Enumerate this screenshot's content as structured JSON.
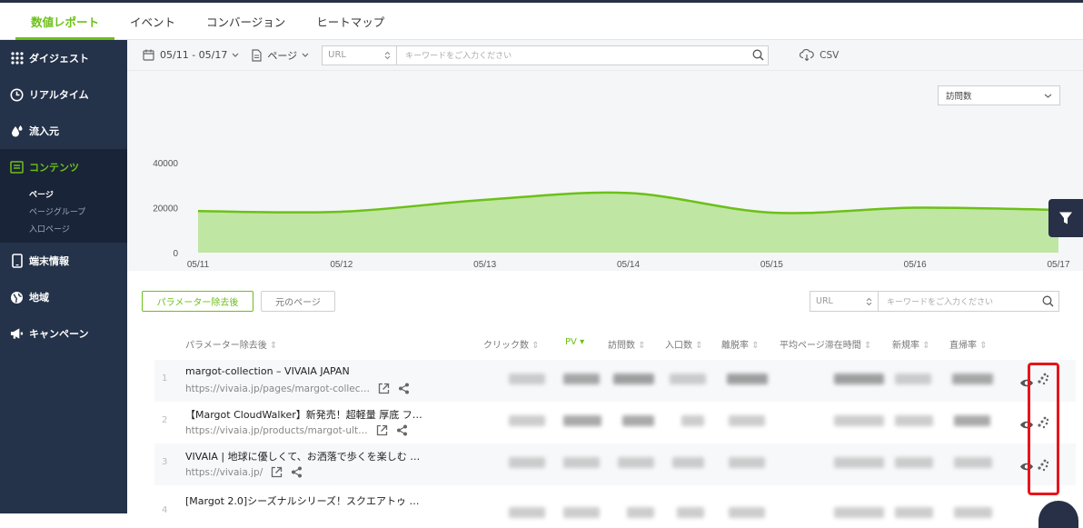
{
  "topnav": {
    "tabs": [
      {
        "label": "数値レポート",
        "active": true
      },
      {
        "label": "イベント",
        "active": false
      },
      {
        "label": "コンバージョン",
        "active": false
      },
      {
        "label": "ヒートマップ",
        "active": false
      }
    ]
  },
  "sidebar": {
    "items": [
      {
        "label": "ダイジェスト",
        "icon": "grid-icon"
      },
      {
        "label": "リアルタイム",
        "icon": "clock-icon"
      },
      {
        "label": "流入元",
        "icon": "drops-icon"
      },
      {
        "label": "コンテンツ",
        "icon": "content-icon",
        "active": true
      },
      {
        "label": "端末情報",
        "icon": "device-icon"
      },
      {
        "label": "地域",
        "icon": "globe-icon"
      },
      {
        "label": "キャンペーン",
        "icon": "megaphone-icon"
      }
    ],
    "content_sub": [
      "ページ",
      "ページグループ",
      "入口ページ"
    ]
  },
  "filterbar": {
    "date_range": "05/11 - 05/17",
    "page_select": "ページ",
    "url_select": "URL",
    "keyword_placeholder": "キーワードをご入力ください",
    "csv_label": "CSV"
  },
  "chart_select": "訪問数",
  "chart_data": {
    "type": "area",
    "x": [
      "05/11",
      "05/12",
      "05/13",
      "05/14",
      "05/15",
      "05/16",
      "05/17"
    ],
    "series": [
      {
        "values": [
          18500,
          18200,
          23500,
          26500,
          17800,
          20000,
          19000
        ]
      }
    ],
    "yticks": [
      "40000",
      "20000",
      "0"
    ],
    "ylim": [
      0,
      40000
    ],
    "color": "#6cc018",
    "fill": "#bfe6a3",
    "grid": false
  },
  "table_tools": {
    "param_button": "パラメーター除去後",
    "original_button": "元のページ",
    "url_select": "URL",
    "keyword_placeholder": "キーワードをご入力ください"
  },
  "table": {
    "headers": [
      "パラメーター除去後",
      "クリック数",
      "PV",
      "訪問数",
      "入口数",
      "離脱率",
      "平均ページ滞在時間",
      "新規率",
      "直帰率"
    ],
    "rows": [
      {
        "num": "1",
        "title": "margot-collection – VIVAIA JAPAN",
        "url": "https://vivaia.jp/pages/margot-collec…"
      },
      {
        "num": "2",
        "title": "【Margot CloudWalker】新発売！超軽量 厚底 フ…",
        "url": "https://vivaia.jp/products/margot-ult…"
      },
      {
        "num": "3",
        "title": "VIVAIA | 地球に優しくて、お洒落で歩くを楽しむ …",
        "url": "https://vivaia.jp/"
      },
      {
        "num": "4",
        "title": "[Margot 2.0]シーズナルシリーズ！スクエアトゥ …",
        "url": ""
      }
    ]
  }
}
